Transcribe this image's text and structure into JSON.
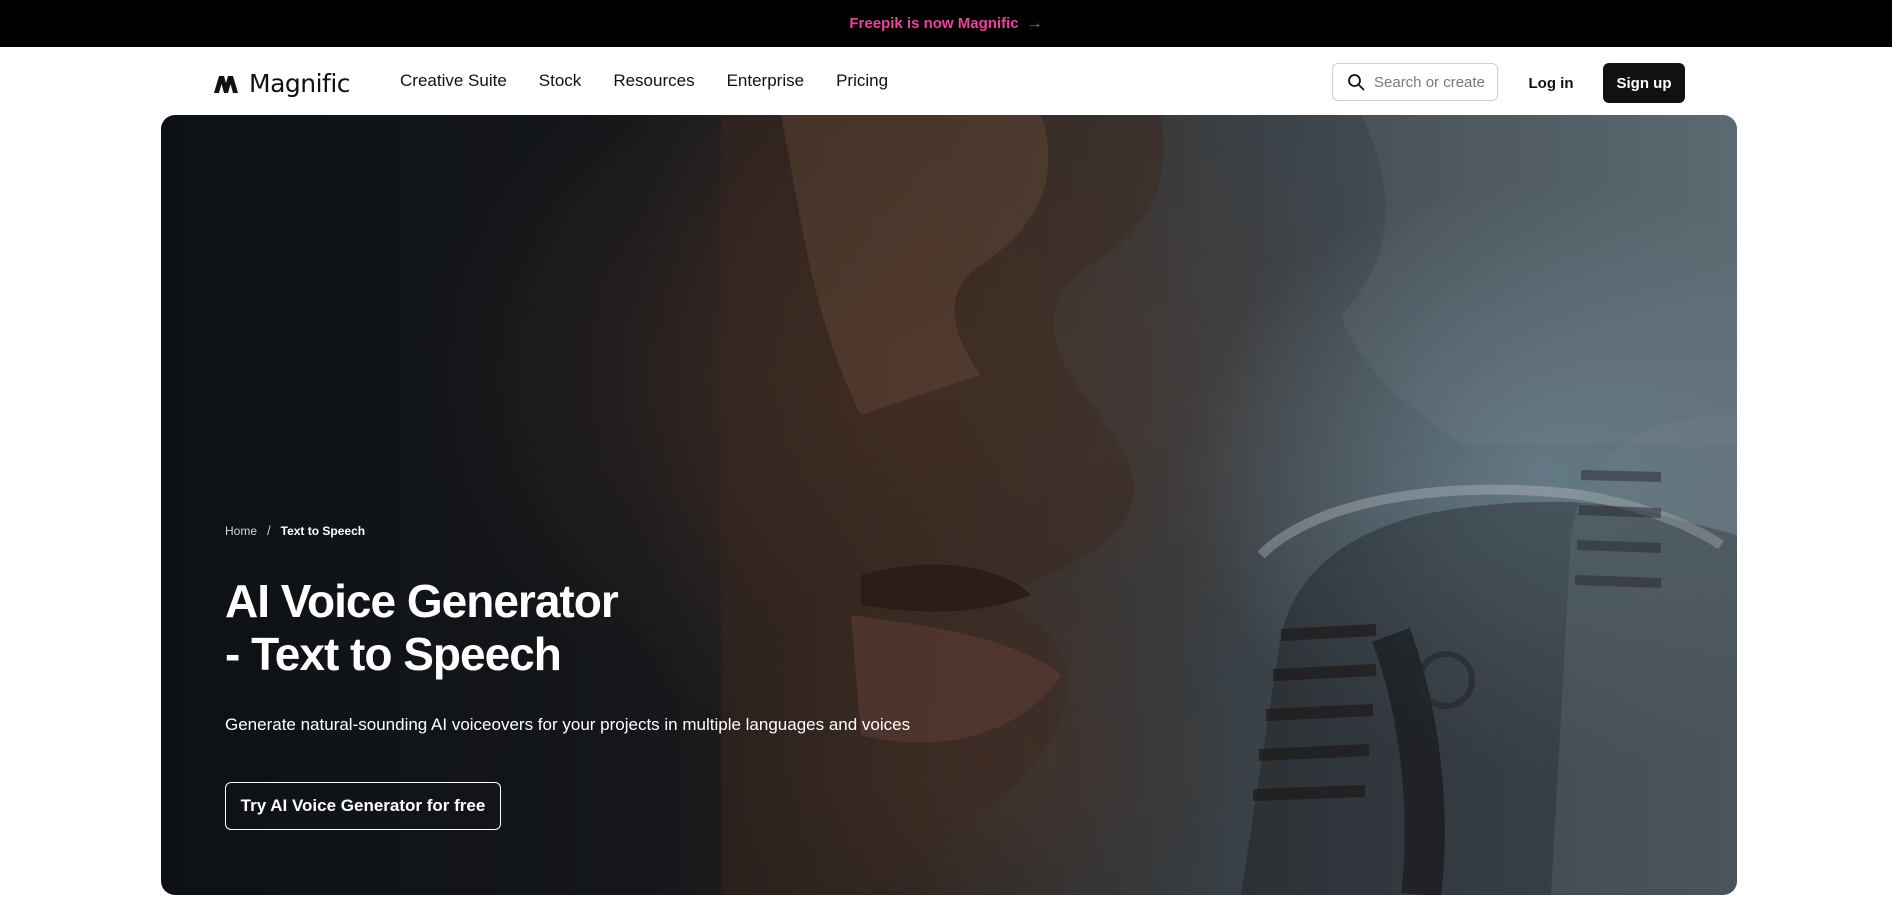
{
  "announcement": {
    "text": "Freepik is now Magnific",
    "arrow": "→"
  },
  "nav": {
    "logo": "Magnific",
    "menu": [
      "Creative Suite",
      "Stock",
      "Resources",
      "Enterprise",
      "Pricing"
    ],
    "search_placeholder": "Search or create",
    "login": "Log in",
    "signup": "Sign up"
  },
  "hero": {
    "breadcrumb": {
      "home": "Home",
      "separator": "/",
      "current": "Text to Speech"
    },
    "title_line1": "AI Voice Generator",
    "title_line2": "- Text to Speech",
    "subtitle": "Generate natural-sounding AI voiceovers for your projects in multiple languages and voices",
    "cta": "Try AI Voice Generator for free"
  },
  "colors": {
    "announcement_accent": "#f0419b",
    "dark": "#111111",
    "hero_base": "#14161a"
  },
  "icons": [
    "magnific-logo-icon",
    "search-icon",
    "arrow-right-icon",
    "microphone-illustration"
  ]
}
